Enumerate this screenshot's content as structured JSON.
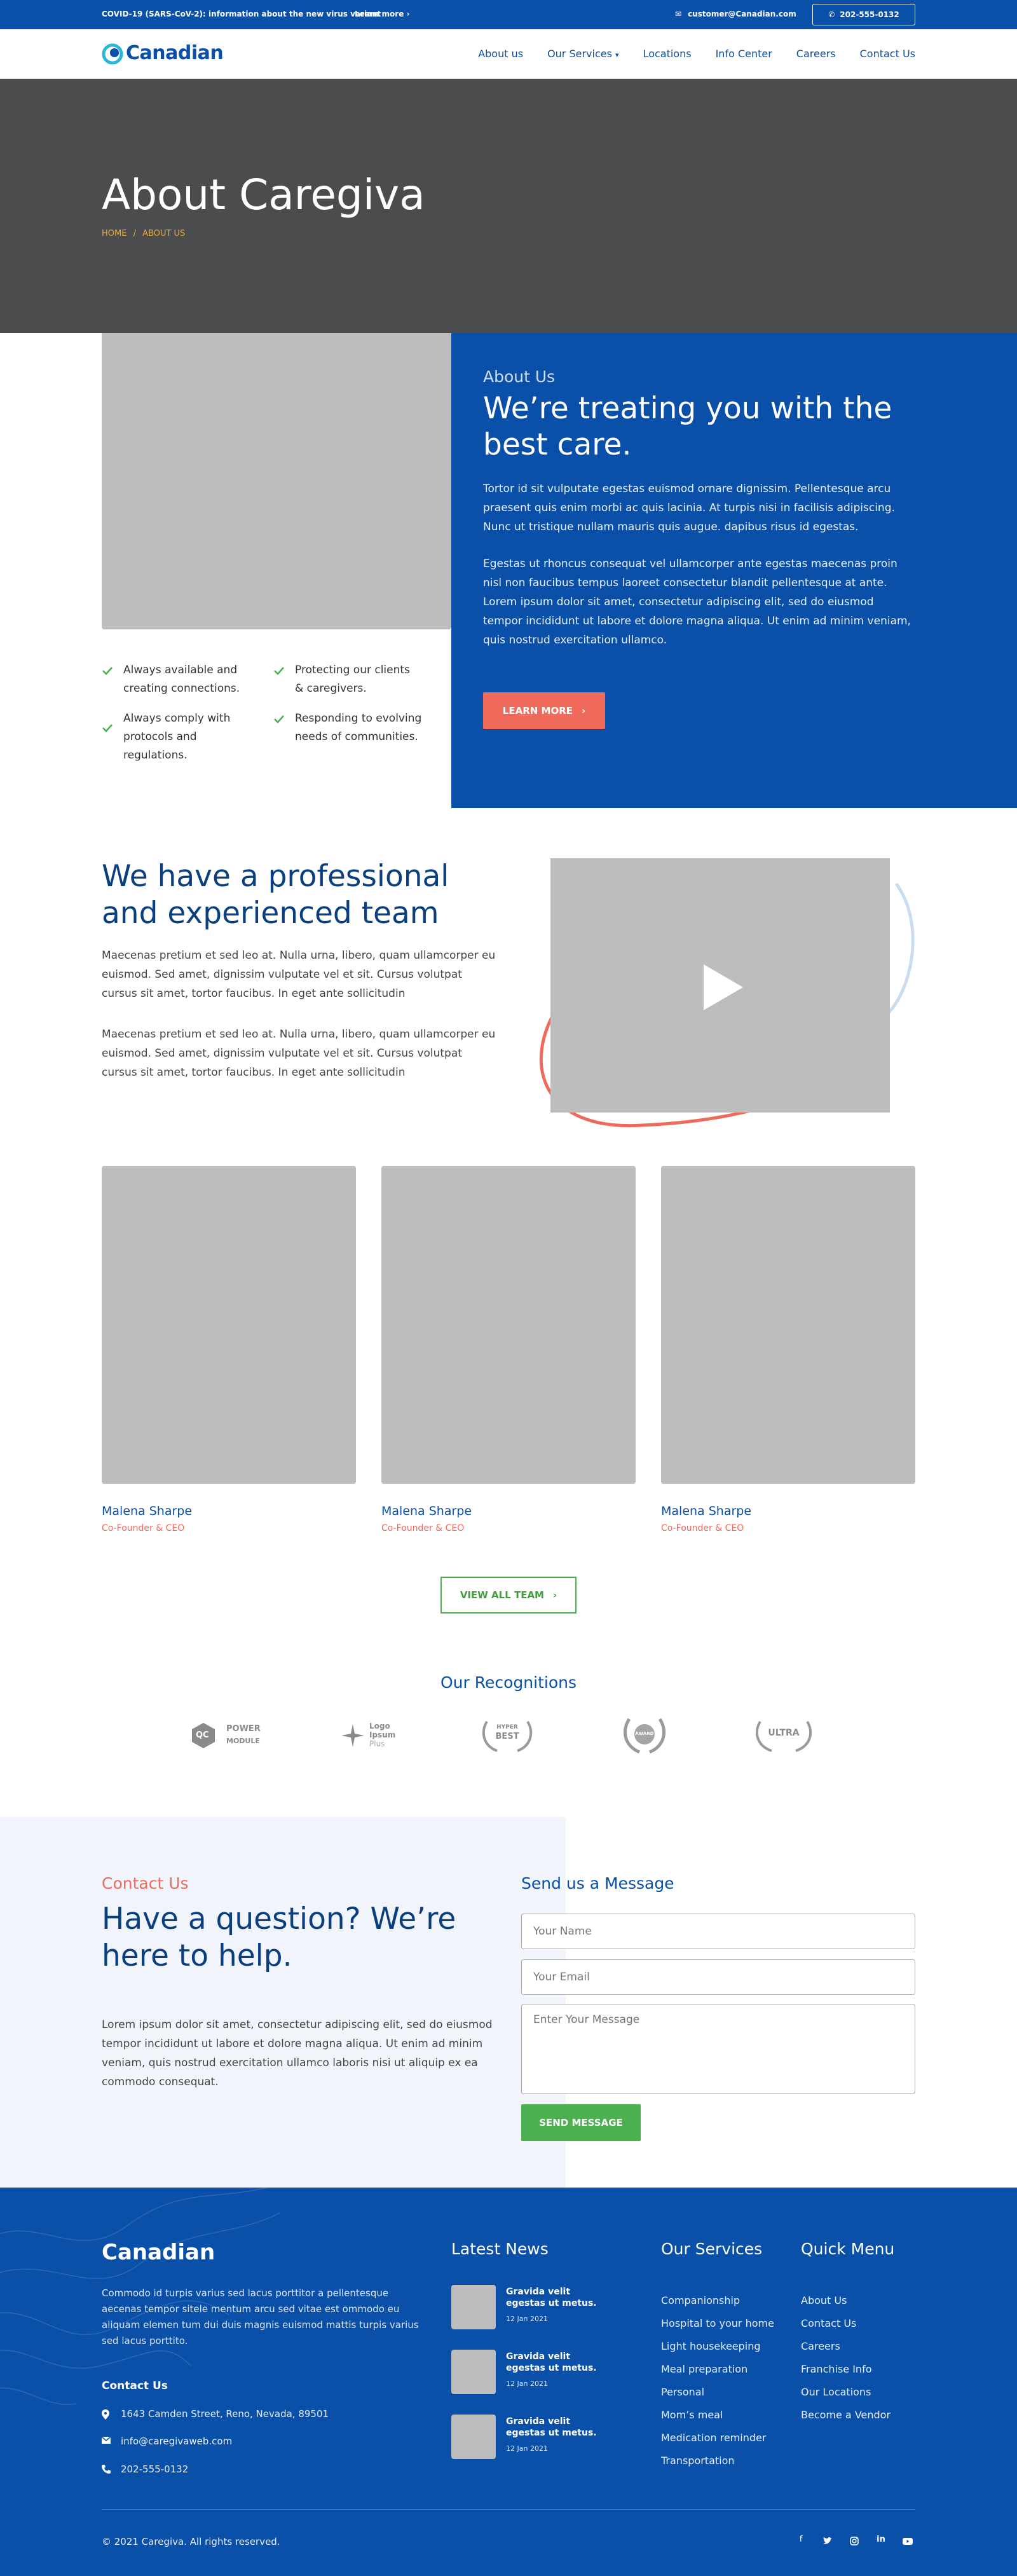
{
  "topbar": {
    "covid_text": "COVID-19 (SARS-CoV-2): information about the new virus variant",
    "learn_more": "Learn more",
    "email": "customer@Canadian.com",
    "phone": "202-555-0132"
  },
  "header": {
    "brand": "Canadian",
    "nav": [
      "About us",
      "Our Services",
      "Locations",
      "Info Center",
      "Careers",
      "Contact Us"
    ]
  },
  "hero": {
    "title": "About Caregiva",
    "breadcrumb_home": "HOME",
    "breadcrumb_sep": "/",
    "breadcrumb_current": "ABOUT US"
  },
  "about": {
    "checks": [
      "Always available and creating connections.",
      "Protecting our clients & caregivers.",
      "Always comply with protocols and regulations.",
      "Responding to evolving needs of communities."
    ],
    "eyebrow": "About Us",
    "heading": "We’re treating you with the best care.",
    "para1": "Tortor id sit vulputate egestas euismod ornare dignissim. Pellentesque arcu praesent quis enim morbi ac quis lacinia. At turpis nisi in facilisis adipiscing. Nunc ut tristique nullam mauris quis augue. dapibus risus id egestas.",
    "para2": "Egestas ut rhoncus consequat vel ullamcorper ante egestas maecenas proin nisl non faucibus tempus laoreet consectetur blandit pellentesque at ante. Lorem ipsum dolor sit amet, consectetur adipiscing elit, sed do eiusmod tempor incididunt ut labore et dolore magna aliqua. Ut enim ad minim veniam, quis nostrud exercitation ullamco.",
    "button": "LEARN MORE"
  },
  "team": {
    "heading": "We have a professional and experienced team",
    "para1": "Maecenas pretium et sed leo at. Nulla urna, libero, quam ullamcorper eu euismod. Sed amet, dignissim vulputate vel et sit. Cursus volutpat cursus sit amet, tortor faucibus. In eget ante sollicitudin",
    "para2": "Maecenas pretium et sed leo at. Nulla urna, libero, quam ullamcorper eu euismod. Sed amet, dignissim vulputate vel et sit. Cursus volutpat cursus sit amet, tortor faucibus. In eget ante sollicitudin",
    "members": [
      {
        "name": "Malena Sharpe",
        "role": "Co-Founder & CEO"
      },
      {
        "name": "Malena Sharpe",
        "role": "Co-Founder & CEO"
      },
      {
        "name": "Malena Sharpe",
        "role": "Co-Founder & CEO"
      }
    ],
    "view_all": "VIEW ALL TEAM"
  },
  "recognitions": {
    "heading": "Our Recognitions",
    "logos": [
      {
        "mark": "QC",
        "line1": "POWER",
        "line2": "MODULE"
      },
      {
        "line1": "Logo",
        "line2": "Ipsum",
        "line3": "Plus"
      },
      {
        "line1": "HYPER",
        "line2": "BEST"
      },
      {
        "line1": "AWARD"
      },
      {
        "line1": "ULTRA"
      }
    ]
  },
  "contact": {
    "eyebrow": "Contact Us",
    "heading": "Have a question? We’re here to help.",
    "paragraph": "Lorem ipsum dolor sit amet, consectetur adipiscing elit, sed do eiusmod tempor incididunt ut labore et dolore magna aliqua. Ut enim ad minim veniam, quis nostrud exercitation ullamco laboris nisi ut aliquip ex ea commodo consequat.",
    "form_heading": "Send us a Message",
    "name_placeholder": "Your Name",
    "email_placeholder": "Your Email",
    "message_placeholder": "Enter Your Message",
    "send": "SEND MESSAGE"
  },
  "footer": {
    "brand": "Canadian",
    "description": "Commodo id turpis varius sed lacus porttitor a pellentesque aecenas tempor sitele mentum arcu sed vitae est ommodo eu aliquam elemen tum dui duis magnis euismod mattis turpis varius sed lacus porttito.",
    "contact_heading": "Contact Us",
    "address": "1643  Camden Street, Reno, Nevada, 89501",
    "email": "info@caregivaweb.com",
    "phone": "202-555-0132",
    "news_heading": "Latest News",
    "news": [
      {
        "title": "Gravida velit egestas ut metus.",
        "date": "12 Jan 2021"
      },
      {
        "title": "Gravida velit egestas ut metus.",
        "date": "12 Jan 2021"
      },
      {
        "title": "Gravida velit egestas ut metus.",
        "date": "12 Jan 2021"
      }
    ],
    "services_heading": "Our Services",
    "services": [
      "Companionship",
      "Hospital to your home",
      "Light housekeeping",
      "Meal preparation",
      "Personal",
      "Mom’s meal",
      "Medication reminder",
      "Transportation"
    ],
    "quick_heading": "Quick Menu",
    "quick": [
      "About Us",
      "Contact Us",
      "Careers",
      "Franchise Info",
      "Our Locations",
      "Become a Vendor"
    ],
    "copyright": "© 2021 Caregiva. All rights reserved.",
    "social_icons": [
      "facebook-icon",
      "twitter-icon",
      "instagram-icon",
      "linkedin-icon",
      "youtube-icon"
    ]
  },
  "colors": {
    "primary_blue": "#0a4fa8",
    "accent_coral": "#ef6a5b",
    "accent_green": "#4caf50",
    "hero_gray": "#4b4c4e"
  }
}
